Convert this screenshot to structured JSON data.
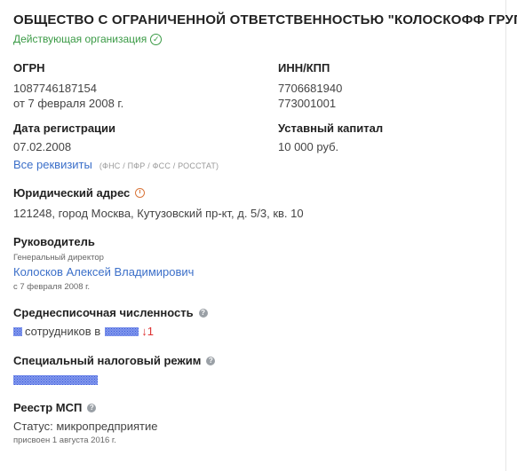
{
  "company": {
    "title": "ОБЩЕСТВО С ОГРАНИЧЕННОЙ ОТВЕТСТВЕННОСТЬЮ \"КОЛОСКОФФ ГРУП\"",
    "status": "Действующая организация"
  },
  "ogrn": {
    "label": "ОГРН",
    "value": "1087746187154",
    "date": "от 7 февраля 2008 г."
  },
  "inn": {
    "label": "ИНН/КПП",
    "inn": "7706681940",
    "kpp": "773001001"
  },
  "reg": {
    "label": "Дата регистрации",
    "value": "07.02.2008"
  },
  "capital": {
    "label": "Уставный капитал",
    "value": "10 000 руб."
  },
  "requisites": {
    "link": "Все реквизиты",
    "note": "(ФНС / ПФР / ФСС / РОССТАТ)"
  },
  "address": {
    "label": "Юридический адрес",
    "value": "121248, город Москва, Кутузовский пр-кт, д. 5/3, кв. 10"
  },
  "head": {
    "label": "Руководитель",
    "position": "Генеральный директор",
    "name": "Колосков Алексей Владимирович",
    "since": "с 7 февраля 2008 г."
  },
  "staff": {
    "label": "Среднесписочная численность",
    "text": "сотрудников в",
    "delta": "↓1"
  },
  "tax": {
    "label": "Специальный налоговый режим"
  },
  "msp": {
    "label": "Реестр МСП",
    "status": "Статус: микропредприятие",
    "date": "присвоен 1 августа 2016 г."
  },
  "icons": {
    "status": "check-circle-icon",
    "address": "clock-icon",
    "help": "question-icon"
  },
  "colors": {
    "accent": "#3b6fc9",
    "active": "#3a9a45",
    "warning": "#d9763b",
    "negative": "#d33333"
  }
}
